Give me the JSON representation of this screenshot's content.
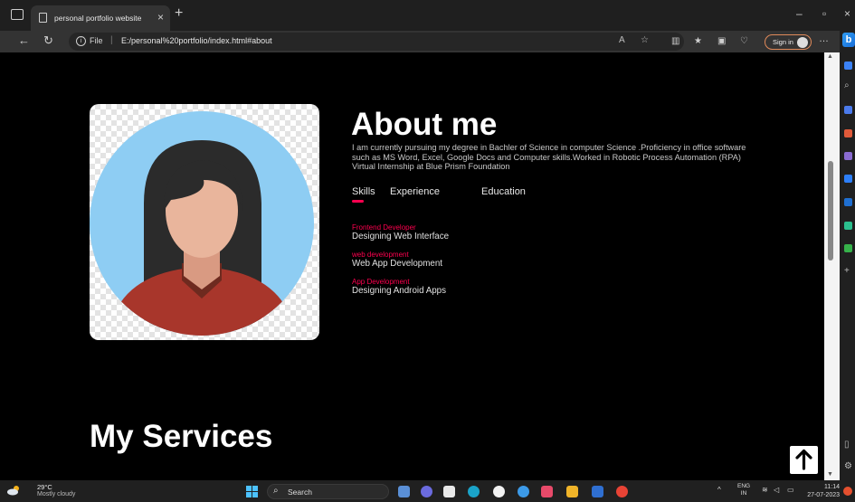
{
  "browser": {
    "tab_title": "personal portfolio website",
    "url_scheme": "File",
    "url": "E:/personal%20portfolio/index.html#about",
    "sign_in": "Sign in"
  },
  "about": {
    "title": "About me",
    "text": "I am currently pursuing my degree in Bachler of Science in computer Science .Proficiency in office software such as MS Word, Excel, Google Docs and Computer skills.Worked in Robotic Process Automation (RPA) Virtual Internship at Blue Prism Foundation",
    "tabs": [
      {
        "label": "Skills",
        "active": true
      },
      {
        "label": "Experience",
        "active": false
      },
      {
        "label": "Education",
        "active": false
      }
    ],
    "skills": [
      {
        "title": "Frontend Developer",
        "desc": "Designing Web Interface"
      },
      {
        "title": "web development",
        "desc": "Web App Development"
      },
      {
        "title": "App Development",
        "desc": "Designing Android Apps"
      }
    ],
    "accent_color": "#ff004f"
  },
  "services": {
    "title": "My Services"
  },
  "taskbar": {
    "temp": "29°C",
    "condition": "Mostly cloudy",
    "search": "Search",
    "lang_top": "ENG",
    "lang_bottom": "IN",
    "time": "11:14",
    "date": "27-07-2023"
  }
}
